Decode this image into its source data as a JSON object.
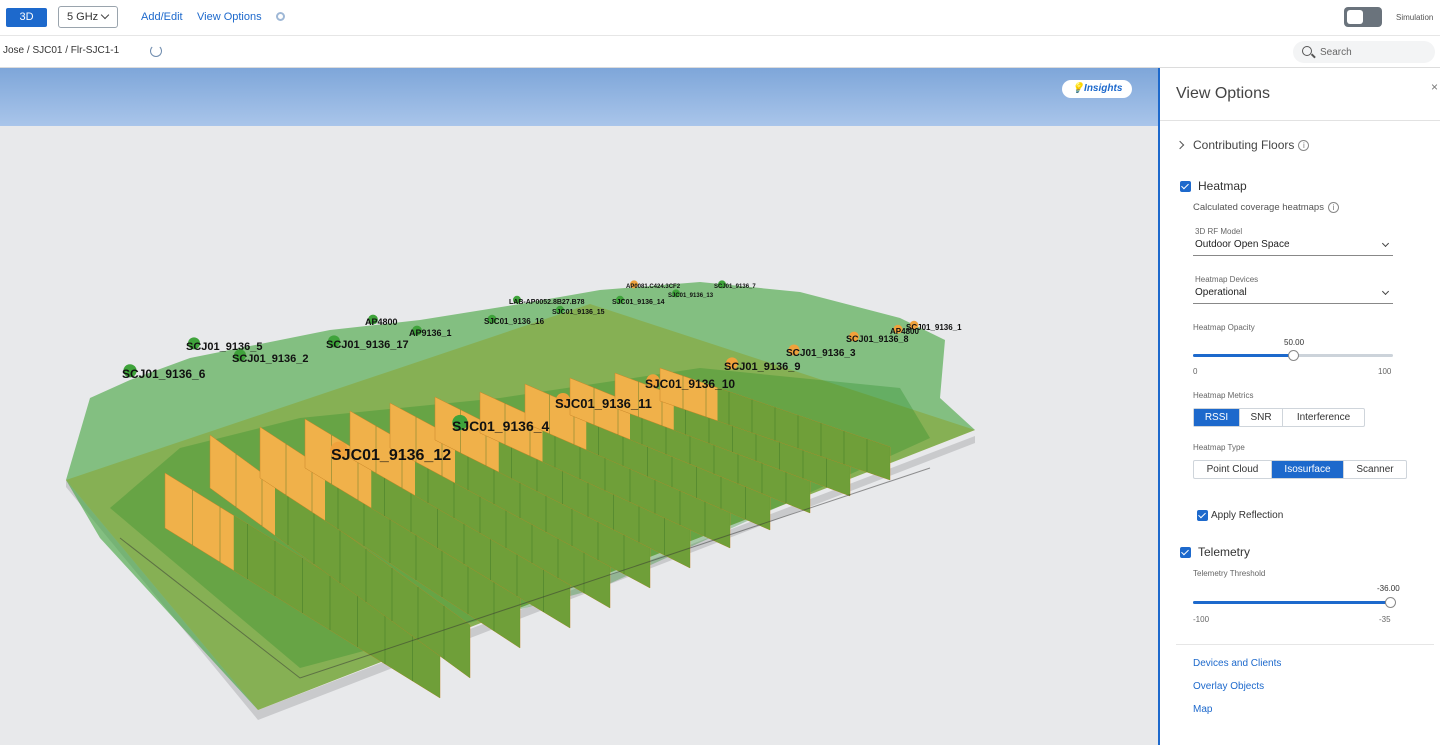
{
  "toolbar": {
    "view_mode": "3D",
    "band": "5 GHz",
    "add_edit": "Add/Edit",
    "view_options": "View Options",
    "simulation_label": "Simulation"
  },
  "breadcrumb": {
    "path": "Jose / SJC01 / Flr-SJC1-1"
  },
  "search": {
    "placeholder": "Search"
  },
  "canvas": {
    "insights_label": "💡Insights",
    "access_points": [
      {
        "label": "SCJ01_9136_6",
        "color": "#3fa33b"
      },
      {
        "label": "SCJ01_9136_5",
        "color": "#3fa33b"
      },
      {
        "label": "SCJ01_9136_2",
        "color": "#3fa33b"
      },
      {
        "label": "SCJ01_9136_17",
        "color": "#3fa33b"
      },
      {
        "label": "AP4800",
        "color": "#3fa33b"
      },
      {
        "label": "AP9136_1",
        "color": "#3fa33b"
      },
      {
        "label": "SJC01_9136_16",
        "color": "#3fa33b"
      },
      {
        "label": "LAB-AP0052.8B27.B78",
        "color": "#3fa33b"
      },
      {
        "label": "SJC01_9136_14",
        "color": "#3fa33b"
      },
      {
        "label": "SJC01_9136_15",
        "color": "#3fa33b"
      },
      {
        "label": "AP0081.C424.3CF2",
        "color": "#f0a23c"
      },
      {
        "label": "SJC01_9136_13",
        "color": "#3fa33b"
      },
      {
        "label": "SCJ01_9136_7",
        "color": "#3fa33b"
      },
      {
        "label": "SCJ01_9136_1",
        "color": "#f0a23c"
      },
      {
        "label": "AP4800",
        "color": "#f0a23c"
      },
      {
        "label": "SCJ01_9136_8",
        "color": "#f0a23c"
      },
      {
        "label": "SCJ01_9136_3",
        "color": "#f0a23c"
      },
      {
        "label": "SCJ01_9136_9",
        "color": "#f0a23c"
      },
      {
        "label": "SJC01_9136_10",
        "color": "#f0a23c"
      },
      {
        "label": "SJC01_9136_11",
        "color": "#f0a23c"
      },
      {
        "label": "SJC01_9136_4",
        "color": "#3fa33b"
      },
      {
        "label": "SJC01_9136_12",
        "color": "#f0a23c"
      }
    ]
  },
  "panel": {
    "title": "View Options",
    "close": "×",
    "contributing_floors": "Contributing Floors",
    "heatmap": {
      "label": "Heatmap",
      "description": "Calculated coverage heatmaps",
      "rf_model_label": "3D RF Model",
      "rf_model_value": "Outdoor Open Space",
      "devices_label": "Heatmap Devices",
      "devices_value": "Operational",
      "opacity_label": "Heatmap Opacity",
      "opacity_value": "50.00",
      "opacity_fraction": 0.5,
      "opacity_min": "0",
      "opacity_max": "100",
      "metrics_label": "Heatmap Metrics",
      "metrics": [
        "RSSI",
        "SNR",
        "Interference"
      ],
      "metrics_selected": "RSSI",
      "type_label": "Heatmap Type",
      "types": [
        "Point Cloud",
        "Isosurface",
        "Scanner"
      ],
      "type_selected": "Isosurface",
      "apply_reflection": "Apply Reflection"
    },
    "telemetry": {
      "label": "Telemetry",
      "threshold_label": "Telemetry Threshold",
      "threshold_value": "-36.00",
      "threshold_min": "-100",
      "threshold_max": "-35",
      "threshold_fraction": 0.985
    },
    "links": [
      "Devices and Clients",
      "Overlay Objects",
      "Map"
    ]
  },
  "colors": {
    "accent": "#1d69cc",
    "coverage_green": "#3fa33b",
    "rack_orange": "#f0b14a",
    "floor_tan": "#f1c27a"
  }
}
